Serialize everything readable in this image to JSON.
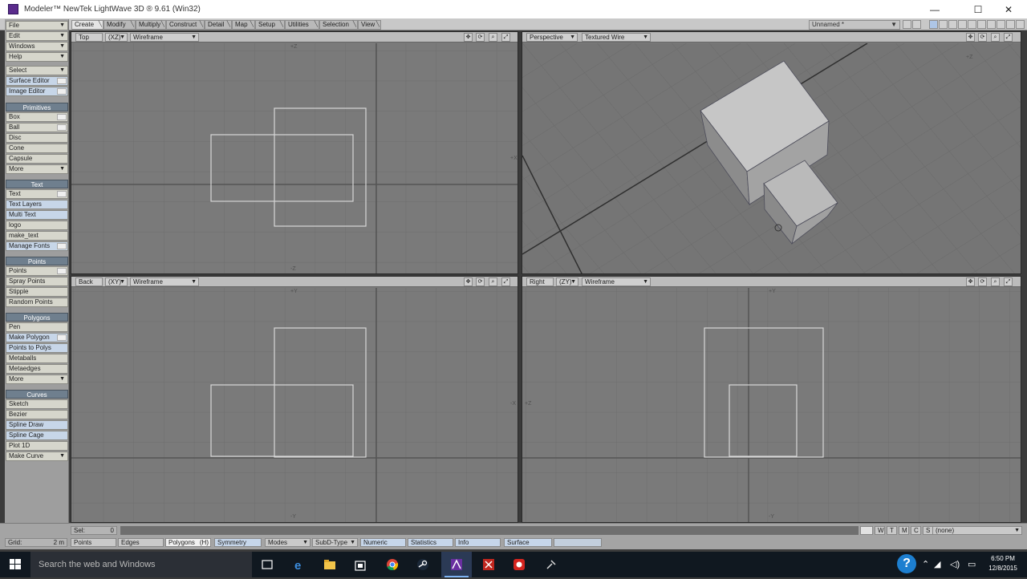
{
  "window": {
    "title": "Modeler™ NewTek LightWave 3D ® 9.61 (Win32)",
    "minimize": "—",
    "maximize": "☐",
    "close": "✕"
  },
  "tabs": [
    {
      "label": "Create",
      "active": true
    },
    {
      "label": "Modify"
    },
    {
      "label": "Multiply"
    },
    {
      "label": "Construct"
    },
    {
      "label": "Detail"
    },
    {
      "label": "Map"
    },
    {
      "label": "Setup"
    },
    {
      "label": "Utilities"
    },
    {
      "label": "Selection"
    },
    {
      "label": "View"
    }
  ],
  "layer_select": "Unnamed *",
  "menus": {
    "file": "File",
    "edit": "Edit",
    "windows": "Windows",
    "help": "Help",
    "select": "Select",
    "surface_editor": "Surface Editor",
    "image_editor": "Image Editor"
  },
  "sections": {
    "primitives": {
      "title": "Primitives",
      "items": [
        "Box",
        "Ball",
        "Disc",
        "Cone",
        "Capsule",
        "More"
      ]
    },
    "text": {
      "title": "Text",
      "items": [
        "Text",
        "Text Layers",
        "Multi Text",
        "logo",
        "make_text",
        "Manage Fonts"
      ]
    },
    "points": {
      "title": "Points",
      "items": [
        "Points",
        "Spray Points",
        "Stipple",
        "Random Points"
      ]
    },
    "polygons": {
      "title": "Polygons",
      "items": [
        "Pen",
        "Make Polygon",
        "Points to Polys",
        "Metaballs",
        "Metaedges",
        "More"
      ]
    },
    "curves": {
      "title": "Curves",
      "items": [
        "Sketch",
        "Bezier",
        "Spline Draw",
        "Spline Cage",
        "Plot 1D",
        "Make Curve"
      ]
    }
  },
  "viewports": {
    "top": {
      "view": "Top",
      "axis": "(XZ)",
      "mode": "Wireframe"
    },
    "persp": {
      "view": "Perspective",
      "mode": "Textured Wire"
    },
    "back": {
      "view": "Back",
      "axis": "(XY)",
      "mode": "Wireframe"
    },
    "right": {
      "view": "Right",
      "axis": "(ZY)",
      "mode": "Wireframe"
    }
  },
  "status": {
    "sel_label": "Sel:",
    "sel_value": "0",
    "grid_label": "Grid:",
    "grid_value": "2 m"
  },
  "modes": {
    "points": "Points",
    "edges": "Edges",
    "polygons": "Polygons",
    "polygons_hotkey": "(H)",
    "symmetry": "Symmetry",
    "modes": "Modes",
    "subd": "SubD-Type",
    "numeric": "Numeric",
    "statistics": "Statistics",
    "info": "Info",
    "surface": "Surface"
  },
  "vmap_buttons": [
    "W",
    "T",
    "M",
    "C",
    "S"
  ],
  "vmap_select": "(none)",
  "taskbar": {
    "search_placeholder": "Search the web and Windows",
    "time": "6:50 PM",
    "date": "12/8/2015"
  }
}
